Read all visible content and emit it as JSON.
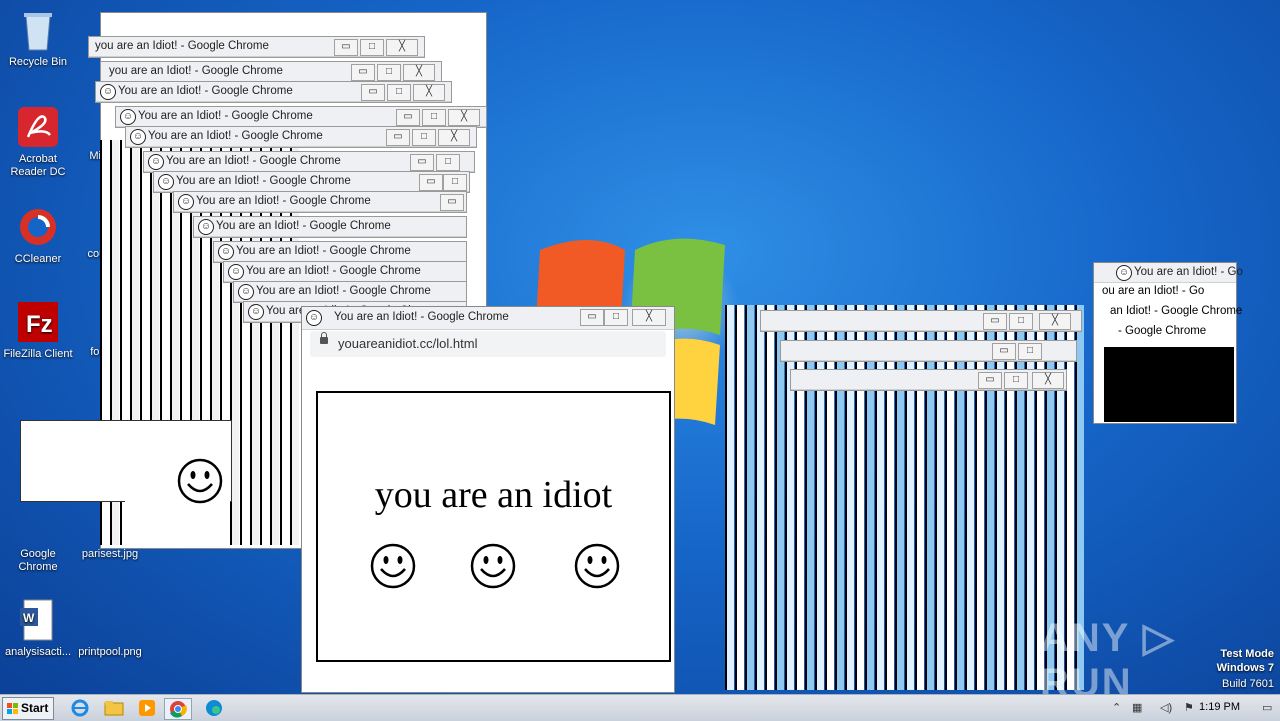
{
  "desktop": {
    "icons": [
      {
        "label": "Recycle Bin"
      },
      {
        "label": "Acrobat Reader DC"
      },
      {
        "label": "CCleaner"
      },
      {
        "label": "FileZilla Client"
      },
      {
        "label": "Google Chrome"
      },
      {
        "label": "analysisacti..."
      },
      {
        "label": "Micr..."
      },
      {
        "label": "coun..."
      },
      {
        "label": "forc..."
      },
      {
        "label": "parisest.jpg"
      },
      {
        "label": "printpool.png"
      }
    ]
  },
  "popup": {
    "title": "You are an Idiot! - Google Chrome",
    "title_trunc_a": "You are an Idiot! - Google Chrome",
    "title_trunc_b": "ou are an Idiot! - Google Chrome",
    "title_trunc_c": "you are an Idiot! - Google Chrome",
    "title_trunc_d": "ou are an Idiot! - Google Chrome",
    "title_trunc_e": "an Idiot! - Google Chrome",
    "url": "youareanidiot.cc/lol.html",
    "headline": "you are an idiot",
    "minimize": "▭",
    "maximize": "□",
    "close": "╳"
  },
  "right_cluster": {
    "title_1": "You are an Idiot! - Go",
    "title_2": "ou are an Idiot! - Go",
    "title_3": "an Idiot! - Google Chrome",
    "title_4": "- Google Chrome"
  },
  "taskbar": {
    "start_label": "Start",
    "clock": "1:19 PM"
  },
  "watermark": {
    "text": "ANY ▷ RUN"
  },
  "test_mode": {
    "line1": "Test Mode",
    "line2": "Windows 7",
    "line3": "Build 7601"
  },
  "colors": {
    "desktop_blue": "#1565c8",
    "window_chrome": "#eef0f3",
    "taskbar": "#d4dbe5"
  }
}
